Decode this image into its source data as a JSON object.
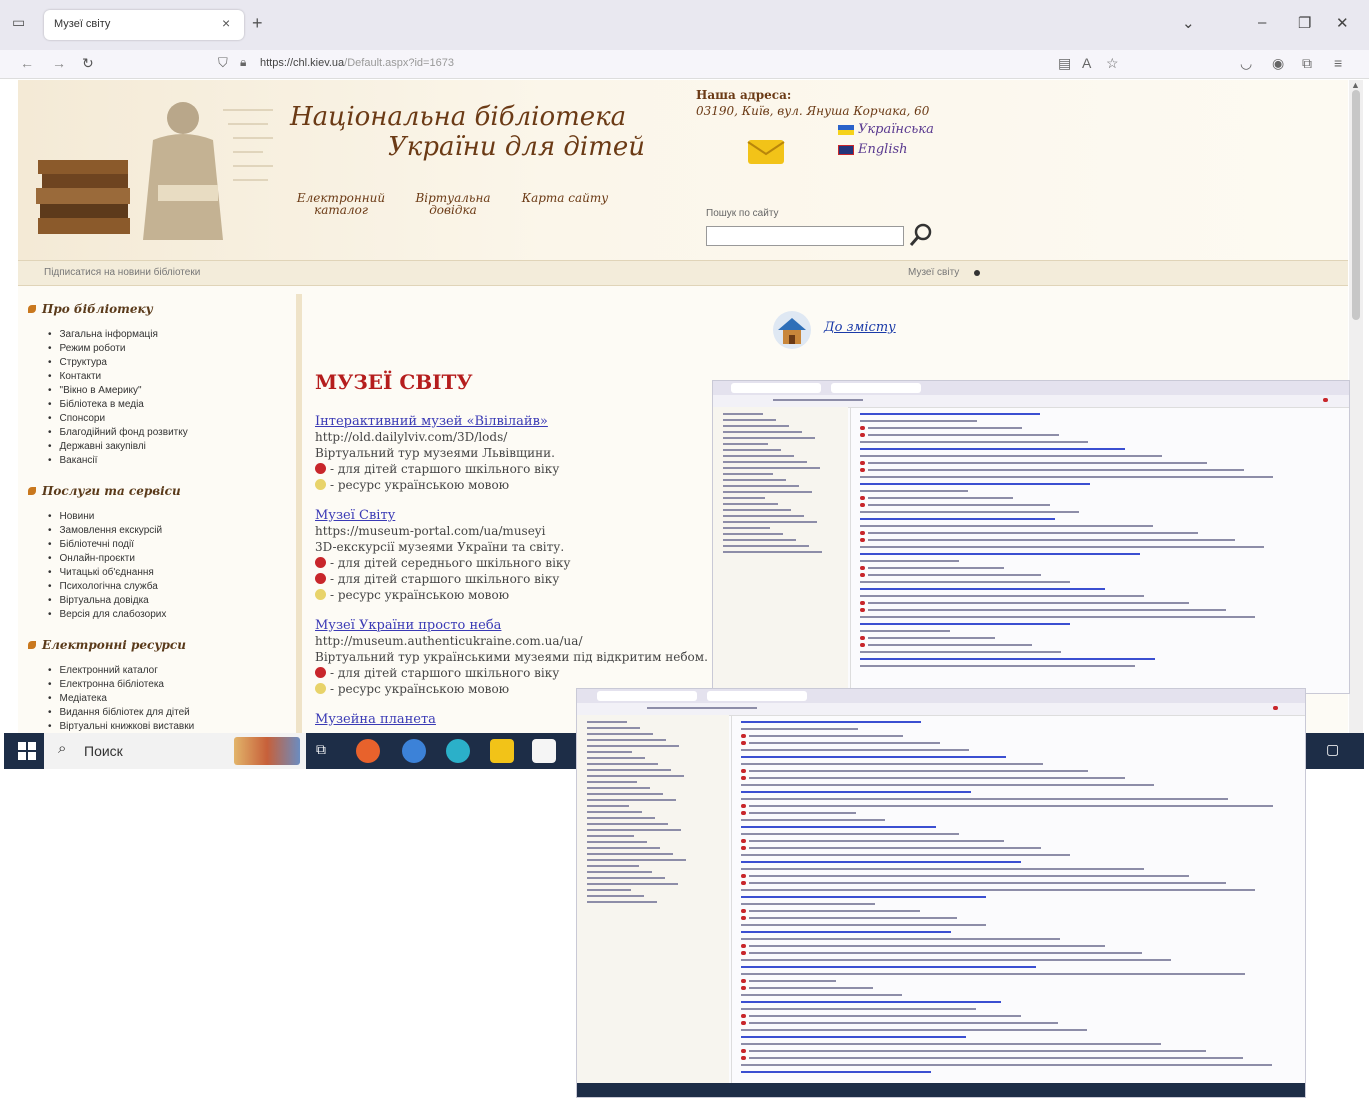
{
  "browser": {
    "tab_title": "Музеї світу",
    "url_domain": "https://chl.kiev.ua",
    "url_path": "/Default.aspx?id=1673"
  },
  "header": {
    "title_line1": "Національна бібліотека",
    "title_line2": "України для дітей",
    "links": [
      "Електронний каталог",
      "Віртуальна довідка",
      "Карта сайту"
    ],
    "address_label": "Наша адреса:",
    "address": "03190, Київ, вул. Януша Корчака, 60",
    "lang_ua": "Українська",
    "lang_en": "English",
    "search_label": "Пошук по сайту"
  },
  "strip": {
    "left": "Підписатися на новини бібліотеки",
    "right": "Музеї світу"
  },
  "sidebar": {
    "sections": [
      {
        "title": "Про бібліотеку",
        "items": [
          "Загальна інформація",
          "Режим роботи",
          "Структура",
          "Контакти",
          "\"Вікно в Америку\"",
          "Бібліотека в медіа",
          "Спонсори",
          "Благодійний фонд розвитку",
          "Державні закупівлі",
          "Вакансії"
        ]
      },
      {
        "title": "Послуги та сервіси",
        "items": [
          "Новини",
          "Замовлення екскурсій",
          "Бібліотечні події",
          "Онлайн-проєкти",
          "Читацькі об'єднання",
          "Психологічна служба",
          "Віртуальна довідка",
          "Версія для слабозорих"
        ]
      },
      {
        "title": "Електронні ресурси",
        "items": [
          "Електронний каталог",
          "Електронна бібліотека",
          "Медіатека",
          "Видання бібліотек для дітей",
          "Віртуальні книжкові виставки"
        ]
      }
    ]
  },
  "main": {
    "home_link": "До змісту",
    "title": "МУЗЕЇ СВІТУ",
    "entries": [
      {
        "name": "Інтерактивний музей «Вілвілайв»",
        "url": "http://old.dailylviv.com/3D/lods/",
        "desc": "Віртуальний тур музеями Львівщини.",
        "badges": [
          {
            "kind": "red",
            "text": "- для дітей старшого шкільного віку"
          },
          {
            "kind": "yellow",
            "text": "- ресурс українською мовою"
          }
        ]
      },
      {
        "name": "Музеї Світу",
        "url": "https://museum-portal.com/ua/museyi",
        "desc": "3D-екскурсії музеями України та світу.",
        "badges": [
          {
            "kind": "red",
            "text": "- для дітей середнього шкільного віку"
          },
          {
            "kind": "red",
            "text": "- для дітей старшого шкільного віку"
          },
          {
            "kind": "yellow",
            "text": "- ресурс українською мовою"
          }
        ]
      },
      {
        "name": "Музеї України просто неба",
        "url": "http://museum.authenticukraine.com.ua/ua/",
        "desc": "Віртуальний тур українськими музеями під відкритим небом.",
        "badges": [
          {
            "kind": "red",
            "text": "- для дітей старшого шкільного віку"
          },
          {
            "kind": "yellow",
            "text": "- ресурс українською мовою"
          }
        ]
      },
      {
        "name": "Музейна планета",
        "url": "",
        "desc": "",
        "badges": []
      }
    ]
  },
  "taskbar": {
    "search_text": "Поиск"
  },
  "colors": {
    "title_red": "#b51d1d",
    "link_blue": "#3a3ab5",
    "brown": "#6b3a15",
    "taskbar": "#1d2d47"
  }
}
